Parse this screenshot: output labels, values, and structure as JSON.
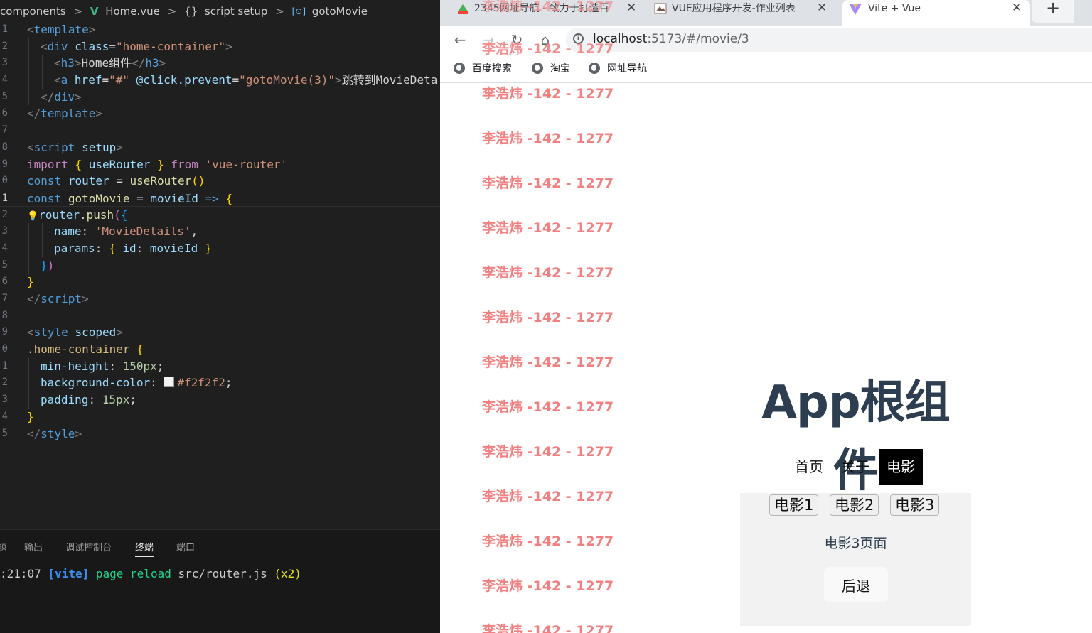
{
  "editor": {
    "breadcrumb": {
      "segments": [
        "components",
        "Home.vue",
        "script setup",
        "gotoMovie"
      ],
      "separator": ">",
      "vue_icon": "V",
      "braces_icon": "{}",
      "symbol_icon": "[⊙]"
    },
    "line_numbers": [
      "1",
      "2",
      "3",
      "4",
      "5",
      "6",
      "7",
      "8",
      "9",
      "0",
      "1",
      "2",
      "3",
      "4",
      "5",
      "6",
      "7",
      "8",
      "9",
      "0",
      "1",
      "2",
      "3",
      "4",
      "5"
    ],
    "code": {
      "l1": [
        "<",
        "template",
        ">"
      ],
      "l2": [
        "<",
        "div",
        " ",
        "class",
        "=",
        "\"home-container\"",
        ">"
      ],
      "l3": [
        "<",
        "h3",
        ">",
        "Home组件",
        "</",
        "h3",
        ">"
      ],
      "l4": [
        "<",
        "a",
        " ",
        "href",
        "=",
        "\"#\"",
        " ",
        "@click.prevent",
        "=",
        "\"gotoMovie(3)\"",
        ">",
        "跳转到MovieDeta"
      ],
      "l5": [
        "</",
        "div",
        ">"
      ],
      "l6": [
        "</",
        "template",
        ">"
      ],
      "l8": [
        "<",
        "script",
        " ",
        "setup",
        ">"
      ],
      "l9": [
        "import",
        " ",
        "{",
        " ",
        "useRouter",
        " ",
        "}",
        " ",
        "from",
        " ",
        "'vue-router'"
      ],
      "l10": [
        "const",
        " ",
        "router",
        " = ",
        "useRouter",
        "()"
      ],
      "l11": [
        "const",
        " ",
        "gotoMovie",
        " = ",
        "movieId",
        " ",
        "=>",
        " ",
        "{"
      ],
      "l12": [
        "router",
        ".",
        "push",
        "(",
        "{"
      ],
      "l13": [
        "name",
        ": ",
        "'MovieDetails'",
        ","
      ],
      "l14": [
        "params",
        ": ",
        "{",
        " ",
        "id",
        ": ",
        "movieId",
        " ",
        "}"
      ],
      "l15": [
        "}",
        ")"
      ],
      "l16": [
        "}"
      ],
      "l17": [
        "</",
        "script",
        ">"
      ],
      "l19": [
        "<",
        "style",
        " ",
        "scoped",
        ">"
      ],
      "l20": [
        ".home-container",
        " ",
        "{"
      ],
      "l21": [
        "min-height",
        ": ",
        "150px",
        ";"
      ],
      "l22": [
        "background-color",
        ": ",
        "#f2f2f2",
        ";"
      ],
      "l23": [
        "padding",
        ": ",
        "15px",
        ";"
      ],
      "l24": [
        "}"
      ],
      "l25": [
        "</",
        "style",
        ">"
      ]
    },
    "bulb_icon": "💡",
    "panel": {
      "tabs": [
        "题",
        "输出",
        "调试控制台",
        "终端",
        "端口"
      ],
      "active_tab": "终端",
      "terminal": {
        "time": ":21:07",
        "tag": "[vite]",
        "msg": "page reload",
        "file": "src/router.js",
        "count": "(x2)"
      }
    }
  },
  "browser": {
    "tabs": [
      {
        "title": "2345网址导航 - 致力于打造百",
        "favicon": "2345-icon"
      },
      {
        "title": "VUE应用程序开发-作业列表",
        "favicon": "course-icon"
      },
      {
        "title": "Vite + Vue",
        "favicon": "vite-icon"
      }
    ],
    "close_glyph": "✕",
    "new_tab_glyph": "+",
    "nav": {
      "back": "←",
      "forward": "→",
      "reload": "↻",
      "home": "⌂"
    },
    "url": {
      "host": "localhost",
      "rest": ":5173/#/movie/3"
    },
    "bookmarks": [
      "百度搜索",
      "淘宝",
      "网址导航"
    ],
    "watermark": "李浩炜 -142 - 1277",
    "watermark_count": 13,
    "app": {
      "title": "App根组件",
      "nav": [
        "首页",
        "关于",
        "电影"
      ],
      "active_nav": "电影",
      "movie_buttons": [
        "电影1",
        "电影2",
        "电影3"
      ],
      "page_text": "电影3页面",
      "back_button": "后退"
    },
    "colors": {
      "watermark": "#f18181",
      "app_title": "#2c3e50",
      "active_nav_bg": "#000000",
      "home_bg": "#f2f2f2"
    }
  }
}
